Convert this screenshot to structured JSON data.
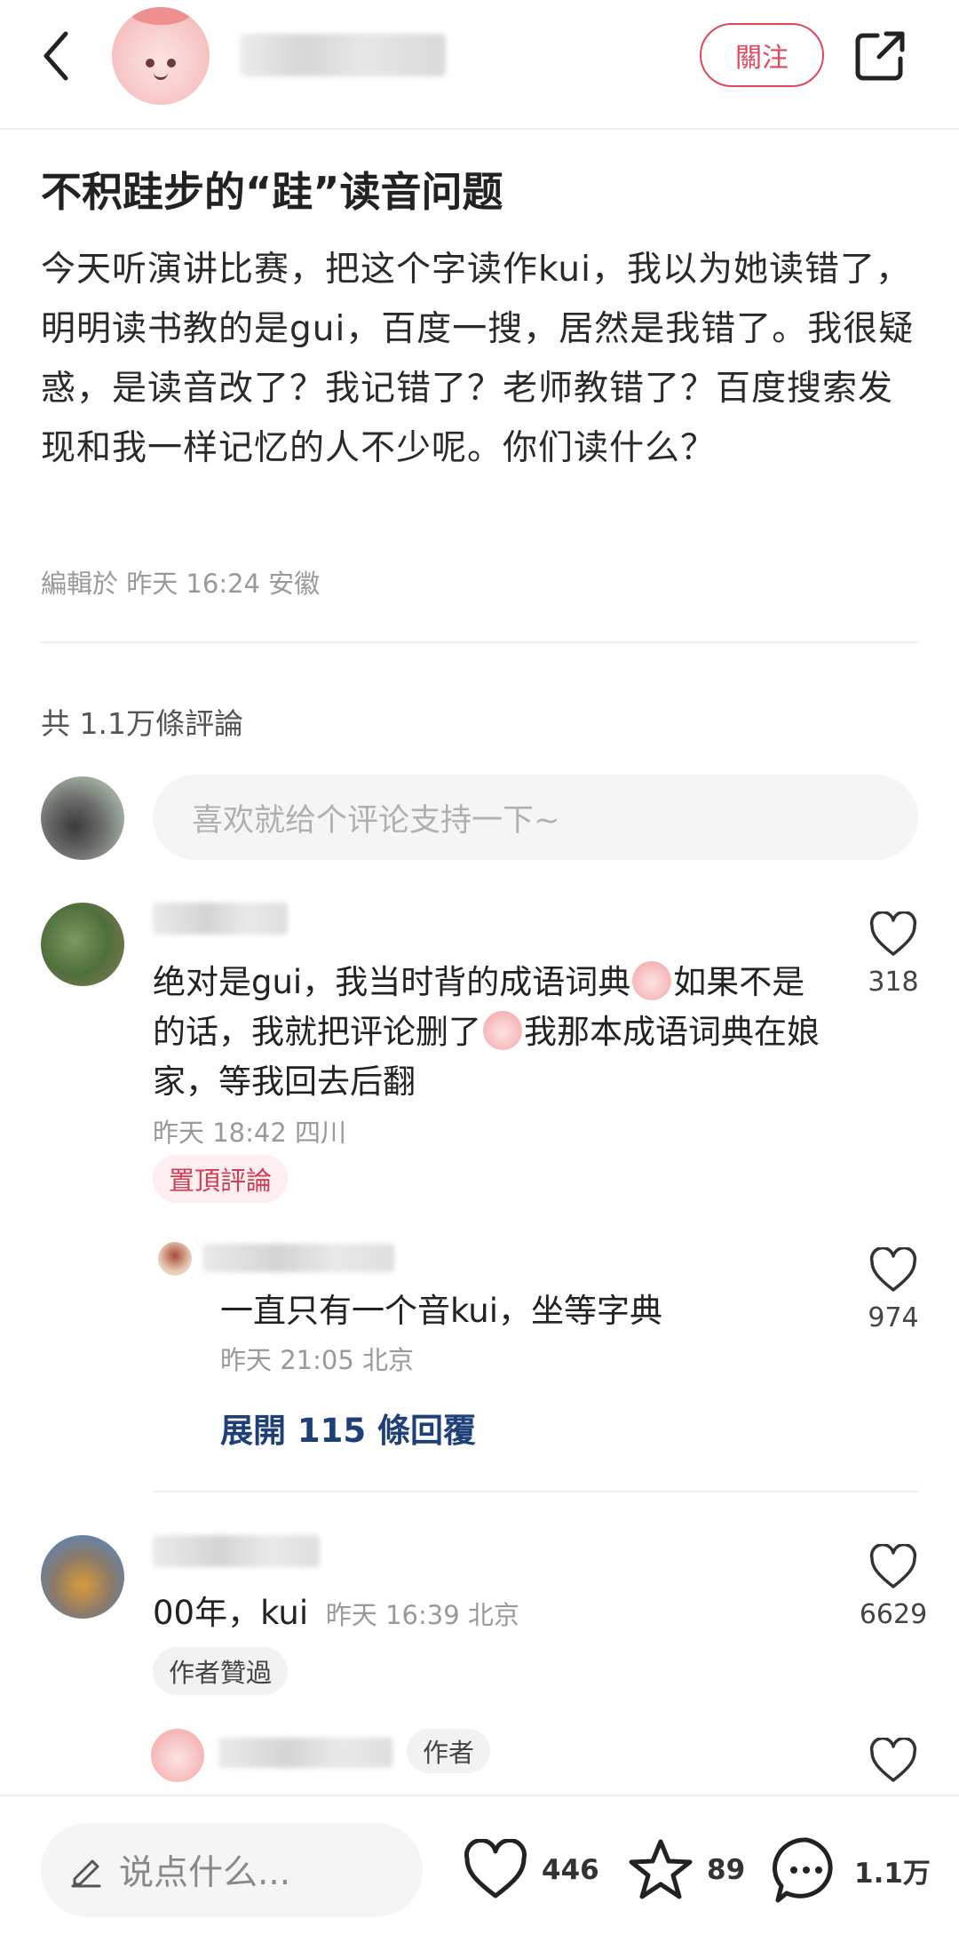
{
  "header": {
    "follow_label": "關注"
  },
  "post": {
    "title": "不积跬步的“跬”读音问题",
    "body": "今天听演讲比赛，把这个字读作kui，我以为她读错了，明明读书教的是gui，百度一搜，居然是我错了。我很疑惑，是读音改了？我记错了？老师教错了？百度搜索发现和我一样记忆的人不少呢。你们读什么？",
    "meta": "編輯於 昨天 16:24 安徽"
  },
  "comments_section": {
    "count_label": "共 1.1万條評論",
    "input_placeholder": "喜欢就给个评论支持一下~"
  },
  "comments": [
    {
      "text_part1": "绝对是gui，我当时背的成语词典",
      "text_part2": "如果不是的话，我就把评论删了",
      "text_part3": "我那本成语词典在娘家，等我回去后翻",
      "meta": "昨天 18:42 四川",
      "likes": "318",
      "tag": "置頂評論",
      "reply": {
        "text": "一直只有一个音kui，坐等字典",
        "meta": "昨天 21:05 北京",
        "likes": "974"
      },
      "expand_label": "展開 115 條回覆"
    },
    {
      "text": "00年，kui",
      "meta": "昨天 16:39 北京",
      "likes": "6629",
      "tag": "作者贊過",
      "reply_author_tag": "作者"
    }
  ],
  "bottom_bar": {
    "say_placeholder": "说点什么...",
    "likes": "446",
    "stars": "89",
    "comments": "1.1万"
  },
  "colors": {
    "accent": "#e0475d",
    "link": "#1f3f78"
  }
}
